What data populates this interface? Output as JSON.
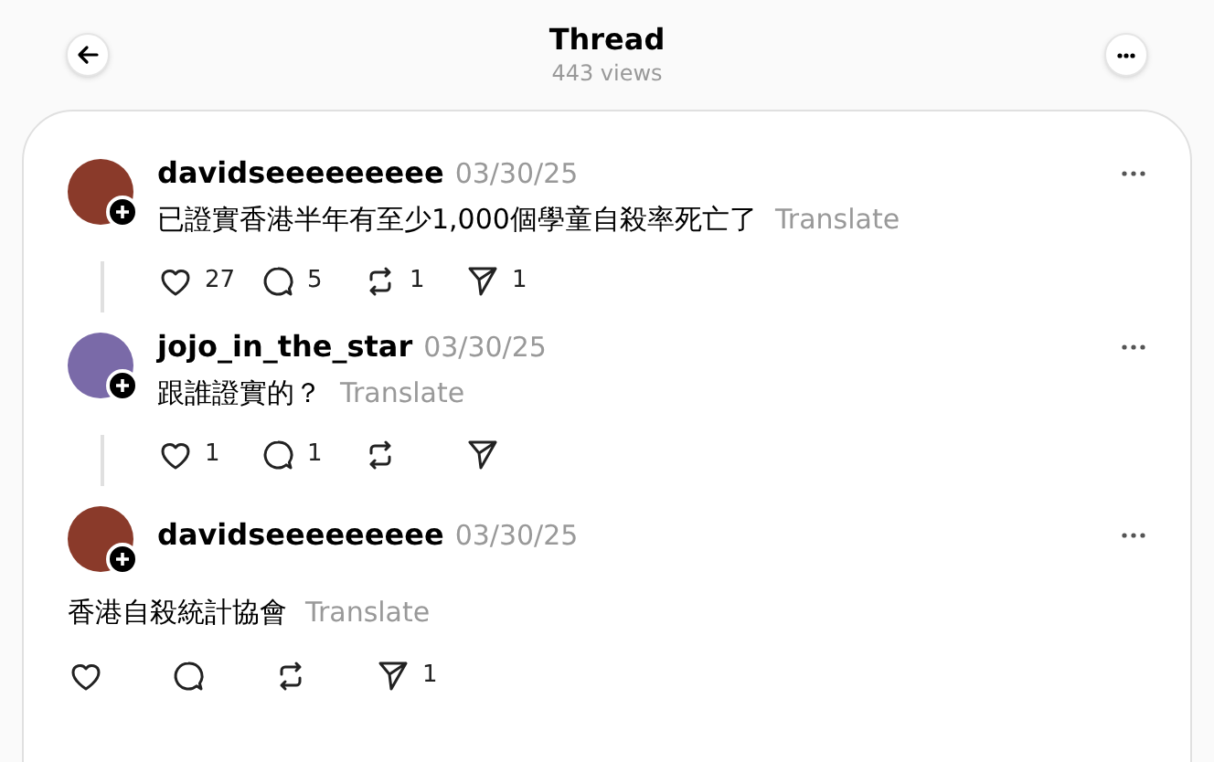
{
  "header": {
    "title": "Thread",
    "views": "443 views"
  },
  "posts": [
    {
      "kind": "reply",
      "author": "davidseeeeeeeee",
      "date": "03/30/25",
      "text": "已證實香港半年有至少1,000個學童自殺率死亡了",
      "translate": "Translate",
      "likes": "27",
      "comments": "5",
      "reposts": "1",
      "shares": "1"
    },
    {
      "kind": "reply",
      "author": "jojo_in_the_star",
      "date": "03/30/25",
      "text": "跟誰證實的？",
      "translate": "Translate",
      "likes": "1",
      "comments": "1"
    },
    {
      "kind": "main",
      "author": "davidseeeeeeeee",
      "date": "03/30/25",
      "text": "香港自殺統計協會",
      "translate": "Translate",
      "shares": "1"
    }
  ]
}
